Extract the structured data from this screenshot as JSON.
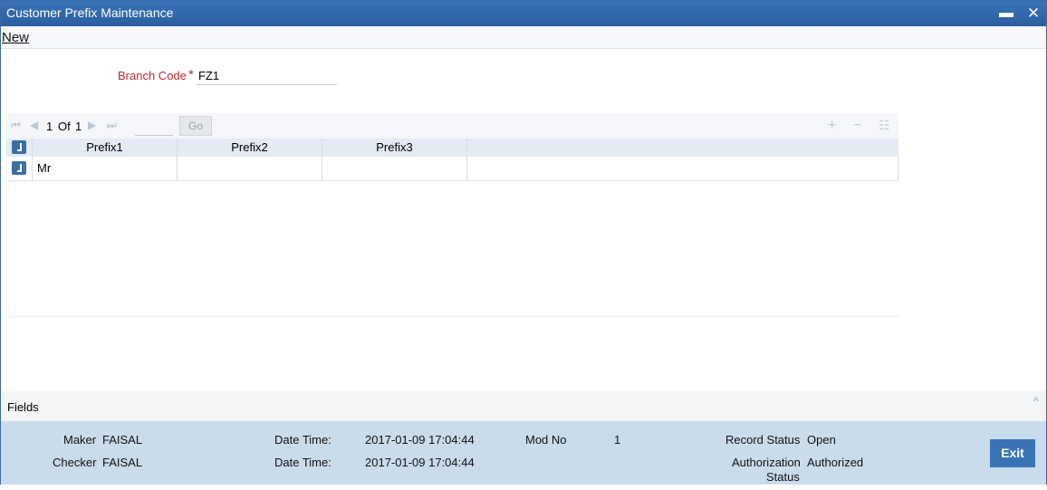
{
  "window": {
    "title": "Customer Prefix Maintenance",
    "minimize": "▬",
    "close": "✕"
  },
  "menu": {
    "new_label": "New"
  },
  "branch": {
    "label": "Branch Code",
    "required_mark": "*",
    "value": "FZ1"
  },
  "pager": {
    "current": "1",
    "of_label": "Of",
    "total": "1",
    "go_label": "Go",
    "first_icon": "first-page-icon",
    "prev_icon": "prev-page-icon",
    "next_icon": "next-page-icon",
    "last_icon": "last-page-icon",
    "add_icon": "plus-icon",
    "remove_icon": "minus-icon",
    "view_icon": "list-icon"
  },
  "grid": {
    "columns": [
      "Prefix1",
      "Prefix2",
      "Prefix3"
    ],
    "rows": [
      {
        "prefix1": "Mr",
        "prefix2": "",
        "prefix3": ""
      }
    ]
  },
  "fields": {
    "label": "Fields",
    "toggle": "^"
  },
  "audit": {
    "maker_label": "Maker",
    "maker": "FAISAL",
    "checker_label": "Checker",
    "checker": "FAISAL",
    "datetime_label": "Date Time:",
    "maker_datetime": "2017-01-09 17:04:44",
    "checker_datetime": "2017-01-09 17:04:44",
    "modno_label": "Mod No",
    "modno": "1",
    "record_status_label": "Record Status",
    "record_status": "Open",
    "auth_status_label_1": "Authorization",
    "auth_status_label_2": "Status",
    "auth_status": "Authorized",
    "exit_label": "Exit"
  },
  "colors": {
    "titlebar": "#2f67ab",
    "required": "#c0272d",
    "footer": "#c9dcec",
    "exit_button": "#3a74b5"
  }
}
